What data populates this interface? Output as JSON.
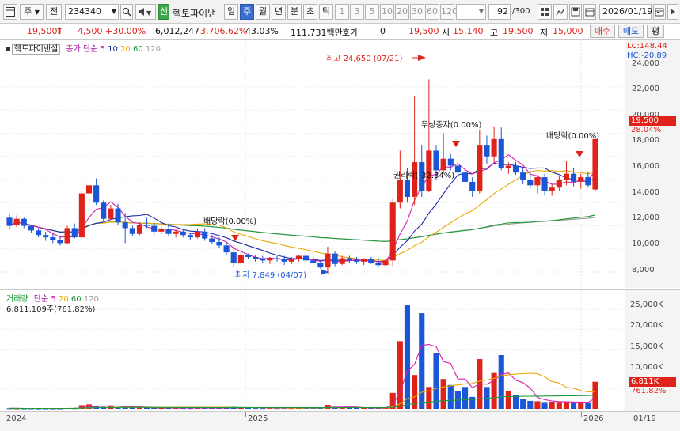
{
  "toolbar": {
    "market": "주",
    "prefix": "전",
    "code": "234340",
    "stock_name": "헥토파이낸",
    "badge": "신",
    "period_buttons": [
      "일",
      "주",
      "월",
      "년",
      "분",
      "초",
      "틱"
    ],
    "period_selected": "주",
    "interval_buttons": [
      "1",
      "3",
      "5",
      "10",
      "20",
      "30",
      "60",
      "120"
    ],
    "count": "92",
    "count_total": "/300",
    "date": "2026/01/19"
  },
  "quote": {
    "price": "19,500",
    "change": "4,500",
    "change_pct": "+30.00%",
    "volume": "6,012,247",
    "volume_ratio": "3,706.62%",
    "turnover": "43.03%",
    "amount": "111,731백만",
    "hoga_label": "호가",
    "hoga_value": "0",
    "close_value": "19,500",
    "open_label": "시",
    "open_value": "15,140",
    "high_label": "고",
    "high_value": "19,500",
    "low_label": "저",
    "low_value": "15,000",
    "buy_button": "매수",
    "sell_button": "매도",
    "avg_button": "평"
  },
  "price_panel": {
    "title": "헥토파이낸셜",
    "ma_label": "종가 단순",
    "ma_periods": [
      "5",
      "10",
      "20",
      "60",
      "120"
    ],
    "lc": "LC:148.44",
    "hc": "HC:-20.89",
    "y_ticks": [
      "24,000",
      "22,000",
      "20,000",
      "18,000",
      "16,000",
      "14,000",
      "12,000",
      "10,000",
      "8,000"
    ],
    "current_price_tag": "19,500",
    "current_pct_tag": "28.04%",
    "annotations": {
      "high": "최고 24,650 (07/21)",
      "low": "최저 7,849 (04/07)",
      "dividend1": "배당락(0.00%)",
      "dividend2": "배당락(0.00%)",
      "bonus": "무상증자(0.00%)",
      "rights": "권리락(-32.34%)"
    }
  },
  "volume_panel": {
    "title": "거래량",
    "ma_label": "단순",
    "ma_periods": [
      "5",
      "20",
      "60",
      "120"
    ],
    "current": "6,811,109주(761.82%)",
    "y_ticks": [
      "25,000K",
      "20,000K",
      "15,000K",
      "10,000K",
      "5,000K"
    ],
    "current_tag": "6,811K",
    "current_pct_tag": "761.82%"
  },
  "x_axis": {
    "labels": [
      "2024",
      "2025",
      "2026"
    ],
    "end_label": "01/19"
  },
  "colors": {
    "up": "#e0231a",
    "down": "#1a56d6",
    "ma5": "#d61fb0",
    "ma10": "#1a2aa8",
    "ma20": "#e8a800",
    "ma60": "#1f9a3a",
    "ma120": "#9a9a9a"
  },
  "chart_data": {
    "type": "candlestick",
    "title": "헥토파이낸셜",
    "x_range": [
      "2024",
      "2026/01/19"
    ],
    "price_ylim": [
      7000,
      25000
    ],
    "volume_ylim": [
      0,
      27000
    ],
    "candles_ohlc": [
      [
        12700,
        13000,
        11700,
        12000
      ],
      [
        12100,
        12900,
        11900,
        12600
      ],
      [
        12600,
        12700,
        11800,
        12000
      ],
      [
        12000,
        12100,
        11400,
        11600
      ],
      [
        11600,
        11800,
        11000,
        11200
      ],
      [
        11200,
        11500,
        10700,
        11000
      ],
      [
        11000,
        11300,
        10500,
        10800
      ],
      [
        10800,
        11100,
        10300,
        10500
      ],
      [
        10500,
        12000,
        10400,
        11800
      ],
      [
        11800,
        12200,
        10900,
        11000
      ],
      [
        11000,
        15000,
        10900,
        14800
      ],
      [
        14800,
        16600,
        14500,
        15500
      ],
      [
        15500,
        16100,
        13800,
        14000
      ],
      [
        14000,
        14200,
        12400,
        12600
      ],
      [
        12600,
        13800,
        12500,
        13500
      ],
      [
        13500,
        13900,
        12100,
        12300
      ],
      [
        12300,
        13100,
        10500,
        11800
      ],
      [
        11800,
        12000,
        11100,
        11300
      ],
      [
        11300,
        12300,
        11200,
        12100
      ],
      [
        12100,
        12700,
        11800,
        12000
      ],
      [
        12000,
        12300,
        11200,
        11500
      ],
      [
        11500,
        11900,
        11300,
        11700
      ],
      [
        11700,
        12200,
        11100,
        11300
      ],
      [
        11300,
        11700,
        11000,
        11500
      ],
      [
        11500,
        11700,
        11000,
        11200
      ],
      [
        11200,
        11400,
        10800,
        11000
      ],
      [
        11000,
        11700,
        10900,
        11500
      ],
      [
        11500,
        11800,
        10700,
        10900
      ],
      [
        10900,
        11200,
        10400,
        10600
      ],
      [
        10600,
        11000,
        10100,
        10300
      ],
      [
        10300,
        10600,
        9500,
        9700
      ],
      [
        9700,
        10300,
        8400,
        8800
      ],
      [
        8800,
        9700,
        8700,
        9500
      ],
      [
        9500,
        9600,
        9100,
        9300
      ],
      [
        9300,
        9500,
        8900,
        9100
      ],
      [
        9100,
        9400,
        8800,
        9000
      ],
      [
        9000,
        9300,
        8700,
        9200
      ],
      [
        9200,
        9400,
        8900,
        9100
      ],
      [
        9100,
        9400,
        8600,
        8900
      ],
      [
        8900,
        9300,
        8700,
        9100
      ],
      [
        9100,
        9500,
        8900,
        9400
      ],
      [
        9400,
        9600,
        8800,
        9000
      ],
      [
        9000,
        9300,
        8700,
        8800
      ],
      [
        8800,
        9000,
        8300,
        8400
      ],
      [
        8400,
        10200,
        7849,
        9600
      ],
      [
        9600,
        9800,
        8500,
        8700
      ],
      [
        8700,
        9400,
        8600,
        9200
      ],
      [
        9200,
        9400,
        8800,
        9000
      ],
      [
        9000,
        9300,
        8700,
        8900
      ],
      [
        8900,
        9200,
        8600,
        9100
      ],
      [
        9100,
        9300,
        8700,
        8800
      ],
      [
        8800,
        9200,
        8400,
        8600
      ],
      [
        8600,
        9100,
        8500,
        9000
      ],
      [
        9000,
        14300,
        8500,
        14000
      ],
      [
        14000,
        18500,
        13500,
        16000
      ],
      [
        16000,
        17000,
        14000,
        14500
      ],
      [
        14500,
        23200,
        13800,
        17500
      ],
      [
        17500,
        19000,
        14500,
        15000
      ],
      [
        15000,
        24650,
        14900,
        18500
      ],
      [
        18500,
        19000,
        16000,
        16800
      ],
      [
        16800,
        20000,
        16500,
        17800
      ],
      [
        17800,
        18200,
        16800,
        17200
      ],
      [
        17200,
        17800,
        16400,
        16600
      ],
      [
        16600,
        17500,
        15300,
        15800
      ],
      [
        15800,
        16200,
        14500,
        15000
      ],
      [
        15000,
        20300,
        14800,
        19000
      ],
      [
        19000,
        19800,
        17300,
        18000
      ],
      [
        18000,
        20600,
        17500,
        19500
      ],
      [
        19500,
        20500,
        16800,
        17000
      ],
      [
        17000,
        17500,
        16500,
        17200
      ],
      [
        17200,
        17500,
        16400,
        16600
      ],
      [
        16600,
        17000,
        15600,
        16000
      ],
      [
        16000,
        16800,
        15200,
        15500
      ],
      [
        15500,
        16400,
        14800,
        16200
      ],
      [
        16200,
        16500,
        14700,
        15000
      ],
      [
        15000,
        15600,
        14600,
        15300
      ],
      [
        15300,
        16300,
        15000,
        16000
      ],
      [
        16000,
        17600,
        15500,
        16500
      ],
      [
        16500,
        17000,
        15400,
        15800
      ],
      [
        15800,
        16500,
        15200,
        16200
      ],
      [
        16200,
        16700,
        15300,
        15500
      ],
      [
        15140,
        19500,
        15000,
        19500
      ]
    ],
    "volume_k": [
      120,
      100,
      90,
      100,
      80,
      90,
      80,
      90,
      200,
      150,
      900,
      1100,
      700,
      500,
      600,
      450,
      650,
      300,
      350,
      330,
      250,
      200,
      220,
      200,
      180,
      170,
      240,
      200,
      230,
      260,
      300,
      500,
      300,
      220,
      180,
      160,
      200,
      170,
      190,
      180,
      210,
      200,
      220,
      300,
      1000,
      400,
      300,
      250,
      220,
      200,
      190,
      230,
      250,
      4000,
      17000,
      26000,
      8500,
      24000,
      5500,
      14000,
      7500,
      6000,
      4500,
      5500,
      3000,
      12500,
      5500,
      9000,
      13500,
      4500,
      3500,
      2500,
      2000,
      1900,
      1700,
      1800,
      1700,
      1700,
      1600,
      1700,
      1500,
      6811
    ]
  }
}
